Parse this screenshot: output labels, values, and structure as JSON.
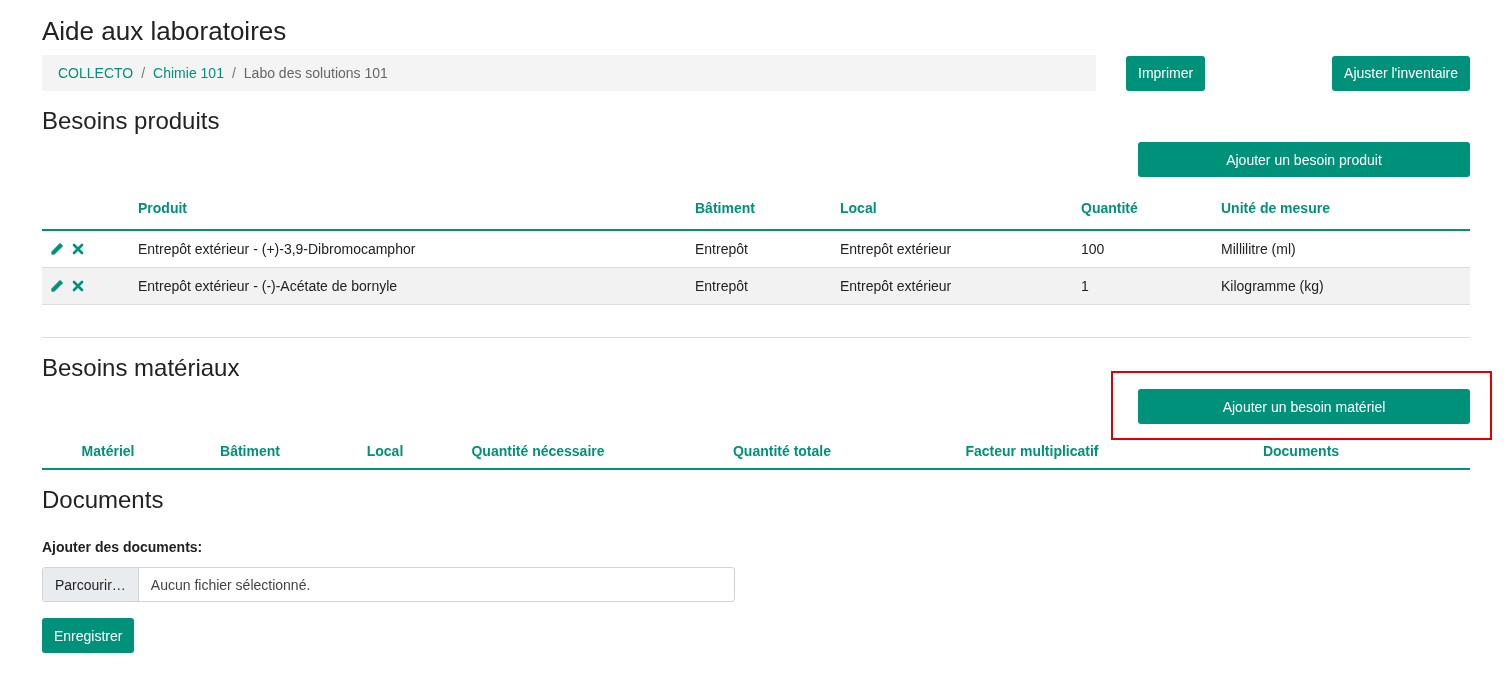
{
  "page_title": "Aide aux laboratoires",
  "breadcrumb": [
    {
      "label": "COLLECTO",
      "kind": "link"
    },
    {
      "label": "Chimie 101",
      "kind": "link"
    },
    {
      "label": "Labo des solutions 101",
      "kind": "current"
    }
  ],
  "breadcrumb_separator": "/",
  "header_buttons": [
    "Imprimer",
    "Ajuster l'inventaire"
  ],
  "products": {
    "title": "Besoins produits",
    "add_button": "Ajouter un besoin produit",
    "columns": [
      "Produit",
      "Bâtiment",
      "Local",
      "Quantité",
      "Unité de mesure"
    ],
    "rows": [
      {
        "cells": [
          "Entrepôt extérieur - (+)-3,9-Dibromocamphor",
          "Entrepôt",
          "Entrepôt extérieur",
          "100",
          "Millilitre (ml)"
        ]
      },
      {
        "cells": [
          "Entrepôt extérieur - (-)-Acétate de bornyle",
          "Entrepôt",
          "Entrepôt extérieur",
          "1",
          "Kilogramme (kg)"
        ]
      }
    ]
  },
  "materials": {
    "title": "Besoins matériaux",
    "add_button": "Ajouter un besoin matériel",
    "add_button_highlighted": true,
    "columns": [
      "Matériel",
      "Bâtiment",
      "Local",
      "Quantité nécessaire",
      "Quantité totale",
      "Facteur multiplicatif",
      "Documents"
    ]
  },
  "documents": {
    "title": "Documents",
    "label": "Ajouter des documents:",
    "browse_button": "Parcourir…",
    "file_status": "Aucun fichier sélectionné.",
    "save_button": "Enregistrer"
  }
}
